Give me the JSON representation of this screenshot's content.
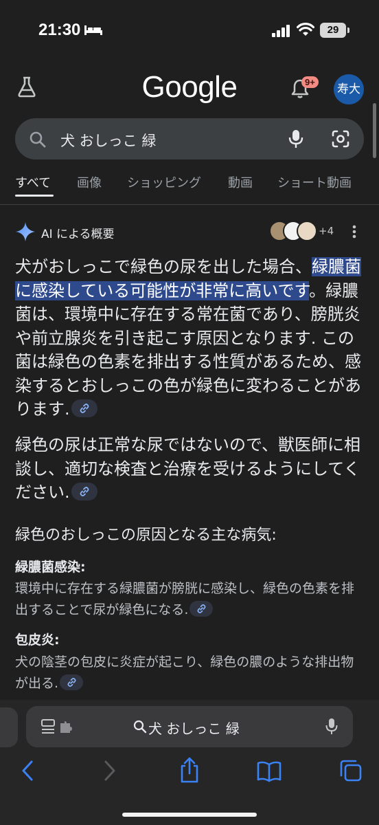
{
  "status_bar": {
    "time": "21:30",
    "battery": "29",
    "icons": [
      "bed-icon",
      "signal-icon",
      "wifi-icon",
      "battery-icon"
    ]
  },
  "header": {
    "logo": "Google",
    "notification_badge": "9+",
    "avatar_initials": "寿大",
    "icons": [
      "flask-icon",
      "bell-icon"
    ]
  },
  "search": {
    "query": "犬 おしっこ 緑",
    "icons": [
      "search-icon",
      "mic-icon",
      "lens-icon"
    ]
  },
  "tabs": [
    {
      "label": "すべて",
      "active": true
    },
    {
      "label": "画像",
      "active": false
    },
    {
      "label": "ショッピング",
      "active": false
    },
    {
      "label": "動画",
      "active": false
    },
    {
      "label": "ショート動画",
      "active": false
    }
  ],
  "ai_overview": {
    "title": "AI による概要",
    "source_count": "+4",
    "paragraph1": {
      "before": "犬がおしっこで緑色の尿を出した場合、",
      "highlight": "緑膿菌に感染している可能性が非常に高いです",
      "after": "。緑膿菌は、環境中に存在する常在菌であり、膀胱炎や前立腺炎を引き起こす原因となります. この菌は緑色の色素を排出する性質があるため、感染するとおしっこの色が緑色に変わることがあります."
    },
    "paragraph2": "緑色の尿は正常な尿ではないので、獣医師に相談し、適切な検査と治療を受けるようにしてください.",
    "causes_heading": "緑色のおしっこの原因となる主な病気:",
    "causes": [
      {
        "title": "緑膿菌感染:",
        "body": "環境中に存在する緑膿菌が膀胱に感染し、緑色の色素を排出することで尿が緑色になる."
      },
      {
        "title": "包皮炎:",
        "body": "犬の陰茎の包皮に炎症が起こり、緑色の膿のような排出物が出る."
      }
    ]
  },
  "browser": {
    "address_text": "犬 おしっこ 緑",
    "icons": [
      "back-icon",
      "forward-icon",
      "share-icon",
      "bookmarks-icon",
      "tabs-icon"
    ]
  },
  "colors": {
    "background": "#1f1f1f",
    "highlight": "#2f4a8c",
    "accent_blue": "#5a9cff",
    "badge": "#f28b82"
  }
}
